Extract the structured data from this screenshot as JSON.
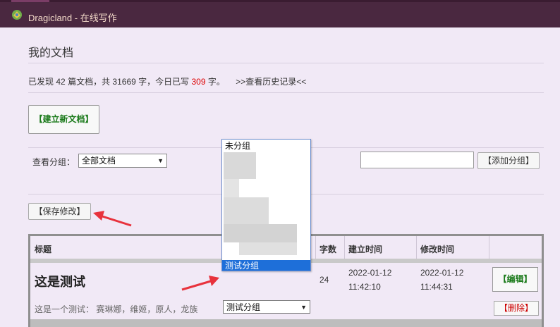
{
  "window": {
    "title": "Dragicland - 在线写作"
  },
  "page": {
    "title": "我的文档"
  },
  "stats": {
    "prefix": "已发现",
    "doc_count": "42",
    "docs_unit": "篇文档，共",
    "word_count": "31669",
    "words_unit": "字，今日已写",
    "today_count": "309",
    "today_unit": "字。",
    "history_link": ">>查看历史记录<<"
  },
  "toolbar": {
    "new_doc": "【建立新文档】",
    "save": "【保存修改】",
    "add_group": "【添加分组】"
  },
  "filter": {
    "label": "查看分组：",
    "selected": "全部文档",
    "arrow": "▼"
  },
  "group_input": {
    "value": ""
  },
  "dropdown": {
    "options": [
      "未分组",
      "测试分组"
    ],
    "highlighted": "测试分组"
  },
  "table": {
    "columns": [
      "标题",
      "字数",
      "建立时间",
      "修改时间"
    ],
    "rows": [
      {
        "title": "这是测试",
        "group": "测试分组",
        "words": "24",
        "created_date": "2022-01-12",
        "created_time": "11:42:10",
        "modified_date": "2022-01-12",
        "modified_time": "11:44:31",
        "description": "这是一个测试： 赛琳娜，维姬，原人，龙族",
        "edit": "【编辑】",
        "delete": "【删除】"
      }
    ]
  },
  "colors": {
    "topbar": "#4a2840",
    "background": "#f1e9f6",
    "green": "#1a7a1a",
    "red": "#dd0000",
    "highlight": "#1e6fd9",
    "annotation": "#e8323c"
  },
  "icons": {
    "logo": "app-logo-icon",
    "dropdown": "chevron-down-icon",
    "annotation": "red-arrow-icon"
  }
}
